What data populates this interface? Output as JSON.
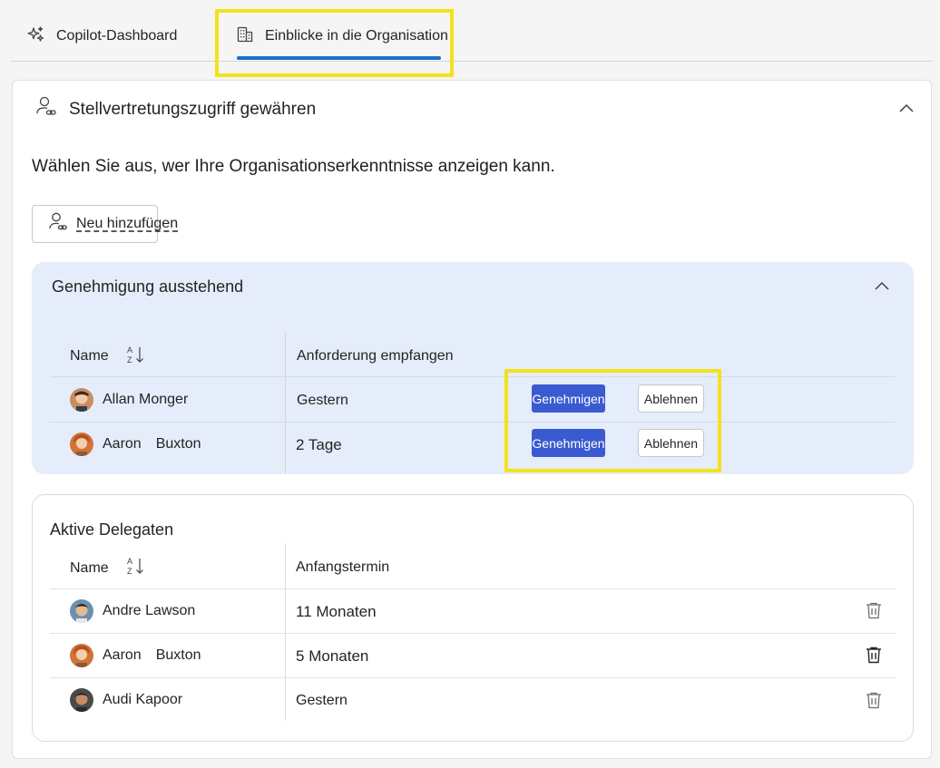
{
  "tabs": [
    {
      "label": "Copilot-Dashboard",
      "icon": "sparkle-icon"
    },
    {
      "label": "Einblicke in die Organisation",
      "icon": "building-icon",
      "active": true
    }
  ],
  "card": {
    "title": "Stellvertretungszugriff gewähren",
    "description": "Wählen Sie aus, wer Ihre Organisationserkenntnisse anzeigen kann.",
    "add_button": "Neu hinzufügen"
  },
  "pending": {
    "title": "Genehmigung ausstehend",
    "headers": {
      "name": "Name",
      "received": "Anforderung empfangen"
    },
    "rows": [
      {
        "first": "Allan Monger",
        "last": "",
        "received": "Gestern",
        "approve": "Genehmigen",
        "reject": "Ablehnen"
      },
      {
        "first": "Aaron",
        "last": "Buxton",
        "received_num": "2",
        "received_unit": "Tage",
        "approve": "Genehmigen",
        "reject": "Ablehnen"
      }
    ]
  },
  "active": {
    "title": "Aktive Delegaten",
    "headers": {
      "name": "Name",
      "start": "Anfangstermin"
    },
    "rows": [
      {
        "first": "Andre Lawson",
        "last": "",
        "start_num": "11",
        "start_unit": "Monaten"
      },
      {
        "first": "Aaron",
        "last": "Buxton",
        "start_num": "5",
        "start_unit": "Monaten"
      },
      {
        "first": "Audi Kapoor",
        "last": "",
        "start": "Gestern"
      }
    ]
  },
  "colors": {
    "accent": "#1a6fc9",
    "approve": "#3a5bd0",
    "pending_bg": "#e5edfb",
    "highlight": "#f3e21c"
  }
}
